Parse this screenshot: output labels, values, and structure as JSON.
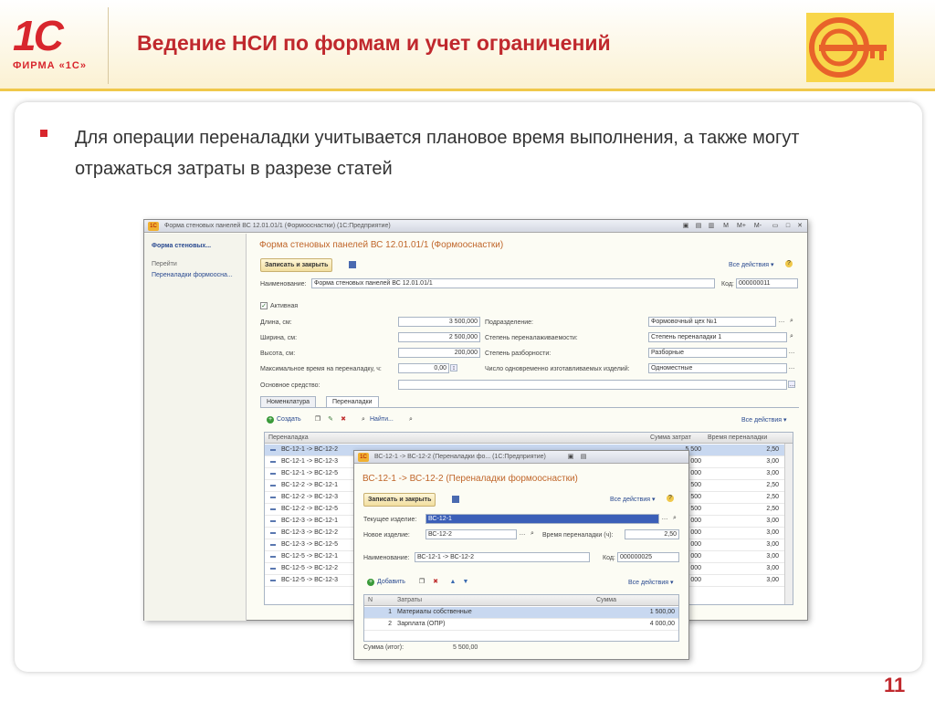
{
  "slide": {
    "title": "Ведение НСИ по формам и учет ограничений",
    "logo_text": "1С",
    "logo_sub": "ФИРМА «1С»",
    "bullet": "Для операции переналадки учитывается плановое время выполнения, а также могут отражаться затраты в разрезе статей",
    "page_number": "11"
  },
  "win1": {
    "title": "Форма стеновых панелей ВС 12.01.01/1 (Формооснастки) (1С:Предприятие)",
    "title_btns": [
      "M",
      "M+",
      "M-"
    ],
    "side_title": "Форма стеновых...",
    "side_goto": "Перейти",
    "side_link": "Переналадки формоосна...",
    "form_title": "Форма стеновых панелей ВС 12.01.01/1 (Формооснастки)",
    "save_close": "Записать и закрыть",
    "all_actions": "Все действия ▾",
    "name_label": "Наименование:",
    "name_value": "Форма стеновых панелей ВС 12.01.01/1",
    "code_label": "Код:",
    "code_value": "000000011",
    "active": "Активная",
    "length_label": "Длина, см:",
    "length_value": "3 500,000",
    "width_label": "Ширина, см:",
    "width_value": "2 500,000",
    "height_label": "Высота, см:",
    "height_value": "200,000",
    "maxtime_label": "Максимальное время на переналадку, ч:",
    "maxtime_value": "0,00",
    "asset_label": "Основное средство:",
    "dept_label": "Подразделение:",
    "dept_value": "Формовочный цех №1",
    "degree_label": "Степень переналаживаемости:",
    "degree_value": "Степень переналадки 1",
    "disasm_label": "Степень разборности:",
    "disasm_value": "Разборные",
    "count_label": "Число одновременно изготавливаемых изделий:",
    "count_value": "Одноместные",
    "tab1": "Номенклатура",
    "tab2": "Переналадки",
    "create": "Создать",
    "find": "Найти...",
    "grid_all_actions": "Все действия ▾",
    "col1": "Переналадка",
    "col2": "Сумма затрат",
    "col3": "Время переналадки",
    "rows": [
      {
        "name": "ВС-12-1 -> ВС-12-2",
        "sum": "5 500",
        "time": "2,50"
      },
      {
        "name": "ВС-12-1 -> ВС-12-3",
        "sum": "000",
        "time": "3,00"
      },
      {
        "name": "ВС-12-1 -> ВС-12-5",
        "sum": "000",
        "time": "3,00"
      },
      {
        "name": "ВС-12-2 -> ВС-12-1",
        "sum": "500",
        "time": "2,50"
      },
      {
        "name": "ВС-12-2 -> ВС-12-3",
        "sum": "500",
        "time": "2,50"
      },
      {
        "name": "ВС-12-2 -> ВС-12-5",
        "sum": "500",
        "time": "2,50"
      },
      {
        "name": "ВС-12-3 -> ВС-12-1",
        "sum": "000",
        "time": "3,00"
      },
      {
        "name": "ВС-12-3 -> ВС-12-2",
        "sum": "000",
        "time": "3,00"
      },
      {
        "name": "ВС-12-3 -> ВС-12-5",
        "sum": "000",
        "time": "3,00"
      },
      {
        "name": "ВС-12-5 -> ВС-12-1",
        "sum": "000",
        "time": "3,00"
      },
      {
        "name": "ВС-12-5 -> ВС-12-2",
        "sum": "000",
        "time": "3,00"
      },
      {
        "name": "ВС-12-5 -> ВС-12-3",
        "sum": "000",
        "time": "3,00"
      }
    ]
  },
  "win2": {
    "title": "ВС-12-1 -> ВС-12-2 (Переналадки фо... (1С:Предприятие)",
    "form_title": "ВС-12-1 -> ВС-12-2 (Переналадки формооснастки)",
    "save_close": "Записать и закрыть",
    "all_actions": "Все действия ▾",
    "cur_label": "Текущее изделие:",
    "cur_value": "ВС-12-1",
    "new_label": "Новое изделие:",
    "new_value": "ВС-12-2",
    "time_label": "Время переналадки (ч):",
    "time_value": "2,50",
    "name_label": "Наименование:",
    "name_value": "ВС-12-1 -> ВС-12-2",
    "code_label": "Код:",
    "code_value": "000000025",
    "add": "Добавить",
    "grid_all_actions": "Все действия ▾",
    "col_n": "N",
    "col_cost": "Затраты",
    "col_sum": "Сумма",
    "rows": [
      {
        "n": "1",
        "cost": "Материалы собственные",
        "sum": "1 500,00"
      },
      {
        "n": "2",
        "cost": "Зарплата (ОПР)",
        "sum": "4 000,00"
      }
    ],
    "total_label": "Сумма (итог):",
    "total_value": "5 500,00"
  }
}
